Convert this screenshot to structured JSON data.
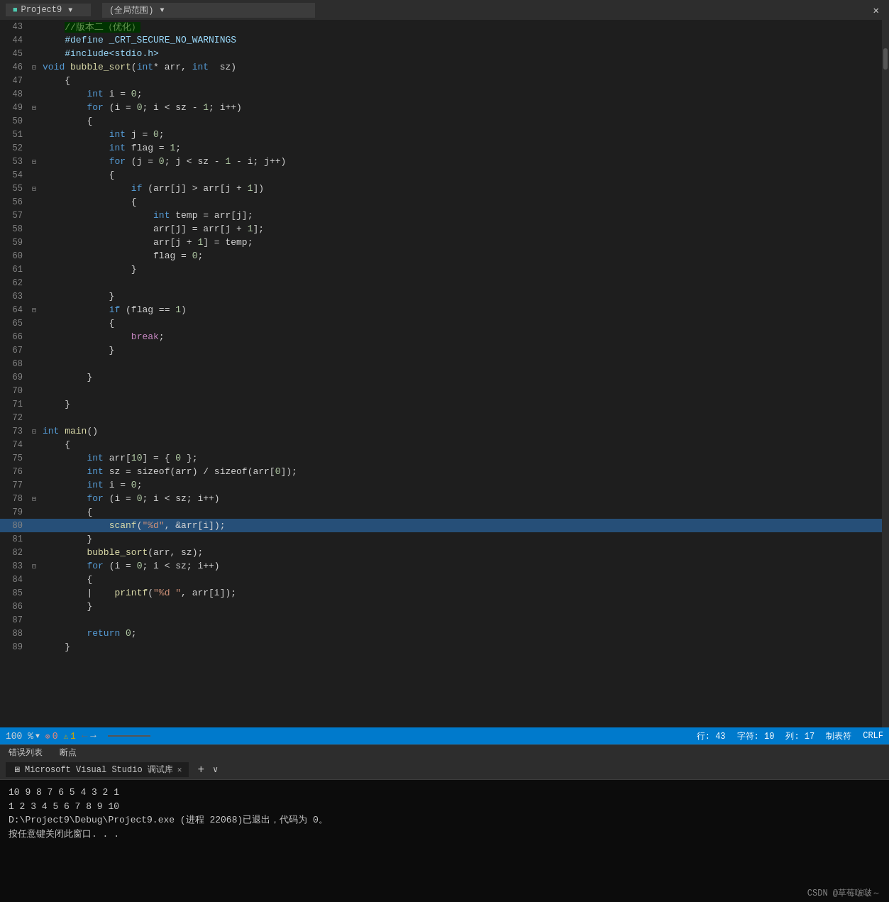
{
  "titlebar": {
    "project": "Project9",
    "scope": "(全局范围)",
    "close": "✕"
  },
  "code": {
    "lines": [
      {
        "num": "43",
        "fold": "",
        "content": [
          {
            "t": "    ",
            "c": ""
          },
          {
            "t": "//版本二（优化）",
            "c": "comment"
          }
        ]
      },
      {
        "num": "44",
        "fold": "",
        "content": [
          {
            "t": "    #define _CRT_SECURE_NO_WARNINGS",
            "c": "prep"
          }
        ]
      },
      {
        "num": "45",
        "fold": "",
        "content": [
          {
            "t": "    #include<stdio.h>",
            "c": "prep2"
          }
        ]
      },
      {
        "num": "46",
        "fold": "⊟",
        "content": [
          {
            "t": "void ",
            "c": "kw"
          },
          {
            "t": "bubble_sort",
            "c": "fn"
          },
          {
            "t": "(",
            "c": "punct"
          },
          {
            "t": "int",
            "c": "kw"
          },
          {
            "t": "* arr, ",
            "c": "op"
          },
          {
            "t": "int",
            "c": "kw"
          },
          {
            "t": "  sz)",
            "c": "op"
          }
        ]
      },
      {
        "num": "47",
        "fold": "",
        "content": [
          {
            "t": "    {",
            "c": ""
          }
        ]
      },
      {
        "num": "48",
        "fold": "",
        "content": [
          {
            "t": "        ",
            "c": ""
          },
          {
            "t": "int",
            "c": "kw"
          },
          {
            "t": " i = ",
            "c": "op"
          },
          {
            "t": "0",
            "c": "num"
          },
          {
            "t": ";",
            "c": "op"
          }
        ]
      },
      {
        "num": "49",
        "fold": "⊟",
        "content": [
          {
            "t": "        ",
            "c": ""
          },
          {
            "t": "for",
            "c": "kw"
          },
          {
            "t": " (i = ",
            "c": "op"
          },
          {
            "t": "0",
            "c": "num"
          },
          {
            "t": "; i < sz - ",
            "c": "op"
          },
          {
            "t": "1",
            "c": "num"
          },
          {
            "t": "; i++)",
            "c": "op"
          }
        ]
      },
      {
        "num": "50",
        "fold": "",
        "content": [
          {
            "t": "        {",
            "c": ""
          }
        ]
      },
      {
        "num": "51",
        "fold": "",
        "content": [
          {
            "t": "            ",
            "c": ""
          },
          {
            "t": "int",
            "c": "kw"
          },
          {
            "t": " j = ",
            "c": "op"
          },
          {
            "t": "0",
            "c": "num"
          },
          {
            "t": ";",
            "c": "op"
          }
        ]
      },
      {
        "num": "52",
        "fold": "",
        "content": [
          {
            "t": "            ",
            "c": ""
          },
          {
            "t": "int",
            "c": "kw"
          },
          {
            "t": " flag = ",
            "c": "op"
          },
          {
            "t": "1",
            "c": "num"
          },
          {
            "t": ";",
            "c": "op"
          }
        ]
      },
      {
        "num": "53",
        "fold": "⊟",
        "content": [
          {
            "t": "            ",
            "c": ""
          },
          {
            "t": "for",
            "c": "kw"
          },
          {
            "t": " (j = ",
            "c": "op"
          },
          {
            "t": "0",
            "c": "num"
          },
          {
            "t": "; j < sz - ",
            "c": "op"
          },
          {
            "t": "1",
            "c": "num"
          },
          {
            "t": " - i; j++)",
            "c": "op"
          }
        ]
      },
      {
        "num": "54",
        "fold": "",
        "content": [
          {
            "t": "            {",
            "c": ""
          }
        ]
      },
      {
        "num": "55",
        "fold": "⊟",
        "content": [
          {
            "t": "                ",
            "c": ""
          },
          {
            "t": "if",
            "c": "kw"
          },
          {
            "t": " (arr[j] > arr[j + ",
            "c": "op"
          },
          {
            "t": "1",
            "c": "num"
          },
          {
            "t": "])",
            "c": "op"
          }
        ]
      },
      {
        "num": "56",
        "fold": "",
        "content": [
          {
            "t": "                {",
            "c": ""
          }
        ]
      },
      {
        "num": "57",
        "fold": "",
        "content": [
          {
            "t": "                    ",
            "c": ""
          },
          {
            "t": "int",
            "c": "kw"
          },
          {
            "t": " temp = arr[j];",
            "c": "op"
          }
        ]
      },
      {
        "num": "58",
        "fold": "",
        "content": [
          {
            "t": "                    arr[j] = arr[j + ",
            "c": "op"
          },
          {
            "t": "1",
            "c": "num"
          },
          {
            "t": "];",
            "c": "op"
          }
        ]
      },
      {
        "num": "59",
        "fold": "",
        "content": [
          {
            "t": "                    arr[j + ",
            "c": "op"
          },
          {
            "t": "1",
            "c": "num"
          },
          {
            "t": "] = temp;",
            "c": "op"
          }
        ]
      },
      {
        "num": "60",
        "fold": "",
        "content": [
          {
            "t": "                    flag = ",
            "c": "op"
          },
          {
            "t": "0",
            "c": "num"
          },
          {
            "t": ";",
            "c": "op"
          }
        ]
      },
      {
        "num": "61",
        "fold": "",
        "content": [
          {
            "t": "                }",
            "c": ""
          }
        ]
      },
      {
        "num": "62",
        "fold": "",
        "content": [
          {
            "t": "",
            "c": ""
          }
        ]
      },
      {
        "num": "63",
        "fold": "",
        "content": [
          {
            "t": "            }",
            "c": ""
          }
        ]
      },
      {
        "num": "64",
        "fold": "⊟",
        "content": [
          {
            "t": "            ",
            "c": ""
          },
          {
            "t": "if",
            "c": "kw"
          },
          {
            "t": " (flag == ",
            "c": "op"
          },
          {
            "t": "1",
            "c": "num"
          },
          {
            "t": ")",
            "c": "op"
          }
        ]
      },
      {
        "num": "65",
        "fold": "",
        "content": [
          {
            "t": "            {",
            "c": ""
          }
        ]
      },
      {
        "num": "66",
        "fold": "",
        "content": [
          {
            "t": "                ",
            "c": ""
          },
          {
            "t": "break",
            "c": "kw2"
          },
          {
            "t": ";",
            "c": "op"
          }
        ]
      },
      {
        "num": "67",
        "fold": "",
        "content": [
          {
            "t": "            }",
            "c": ""
          }
        ]
      },
      {
        "num": "68",
        "fold": "",
        "content": [
          {
            "t": "",
            "c": ""
          }
        ]
      },
      {
        "num": "69",
        "fold": "",
        "content": [
          {
            "t": "        }",
            "c": ""
          }
        ]
      },
      {
        "num": "70",
        "fold": "",
        "content": [
          {
            "t": "",
            "c": ""
          }
        ]
      },
      {
        "num": "71",
        "fold": "",
        "content": [
          {
            "t": "    }",
            "c": ""
          }
        ]
      },
      {
        "num": "72",
        "fold": "",
        "content": [
          {
            "t": "",
            "c": ""
          }
        ]
      },
      {
        "num": "73",
        "fold": "⊟",
        "content": [
          {
            "t": "int",
            "c": "kw"
          },
          {
            "t": " ",
            "c": ""
          },
          {
            "t": "main",
            "c": "fn"
          },
          {
            "t": "()",
            "c": "op"
          }
        ]
      },
      {
        "num": "74",
        "fold": "",
        "content": [
          {
            "t": "    {",
            "c": ""
          }
        ]
      },
      {
        "num": "75",
        "fold": "",
        "content": [
          {
            "t": "        ",
            "c": ""
          },
          {
            "t": "int",
            "c": "kw"
          },
          {
            "t": " arr[",
            "c": "op"
          },
          {
            "t": "10",
            "c": "num"
          },
          {
            "t": "] = { ",
            "c": "op"
          },
          {
            "t": "0",
            "c": "num"
          },
          {
            "t": " };",
            "c": "op"
          }
        ]
      },
      {
        "num": "76",
        "fold": "",
        "content": [
          {
            "t": "        ",
            "c": ""
          },
          {
            "t": "int",
            "c": "kw"
          },
          {
            "t": " sz = sizeof(arr) / sizeof(arr[",
            "c": "op"
          },
          {
            "t": "0",
            "c": "num"
          },
          {
            "t": "]);",
            "c": "op"
          }
        ]
      },
      {
        "num": "77",
        "fold": "",
        "content": [
          {
            "t": "        ",
            "c": ""
          },
          {
            "t": "int",
            "c": "kw"
          },
          {
            "t": " i = ",
            "c": "op"
          },
          {
            "t": "0",
            "c": "num"
          },
          {
            "t": ";",
            "c": "op"
          }
        ]
      },
      {
        "num": "78",
        "fold": "⊟",
        "content": [
          {
            "t": "        ",
            "c": ""
          },
          {
            "t": "for",
            "c": "kw"
          },
          {
            "t": " (i = ",
            "c": "op"
          },
          {
            "t": "0",
            "c": "num"
          },
          {
            "t": "; i < sz; i++)",
            "c": "op"
          }
        ]
      },
      {
        "num": "79",
        "fold": "",
        "content": [
          {
            "t": "        {",
            "c": ""
          }
        ]
      },
      {
        "num": "80",
        "fold": "",
        "content": [
          {
            "t": "            ",
            "c": ""
          },
          {
            "t": "scanf",
            "c": "fn"
          },
          {
            "t": "(",
            "c": "op"
          },
          {
            "t": "\"%d\"",
            "c": "str"
          },
          {
            "t": ", &arr[i]);",
            "c": "op"
          }
        ],
        "highlight": true
      },
      {
        "num": "81",
        "fold": "",
        "content": [
          {
            "t": "        }",
            "c": ""
          }
        ]
      },
      {
        "num": "82",
        "fold": "",
        "content": [
          {
            "t": "        ",
            "c": ""
          },
          {
            "t": "bubble_sort",
            "c": "fn"
          },
          {
            "t": "(arr, sz);",
            "c": "op"
          }
        ]
      },
      {
        "num": "83",
        "fold": "⊟",
        "content": [
          {
            "t": "        ",
            "c": ""
          },
          {
            "t": "for",
            "c": "kw"
          },
          {
            "t": " (i = ",
            "c": "op"
          },
          {
            "t": "0",
            "c": "num"
          },
          {
            "t": "; i < sz; i++)",
            "c": "op"
          }
        ]
      },
      {
        "num": "84",
        "fold": "",
        "content": [
          {
            "t": "        {",
            "c": ""
          }
        ]
      },
      {
        "num": "85",
        "fold": "",
        "content": [
          {
            "t": "        |    ",
            "c": ""
          },
          {
            "t": "printf",
            "c": "fn"
          },
          {
            "t": "(",
            "c": "op"
          },
          {
            "t": "\"%d \"",
            "c": "str"
          },
          {
            "t": ", arr[i]);",
            "c": "op"
          }
        ]
      },
      {
        "num": "86",
        "fold": "",
        "content": [
          {
            "t": "        }",
            "c": ""
          }
        ]
      },
      {
        "num": "87",
        "fold": "",
        "content": [
          {
            "t": "",
            "c": ""
          }
        ]
      },
      {
        "num": "88",
        "fold": "",
        "content": [
          {
            "t": "        ",
            "c": ""
          },
          {
            "t": "return",
            "c": "kw"
          },
          {
            "t": " ",
            "c": ""
          },
          {
            "t": "0",
            "c": "num"
          },
          {
            "t": ";",
            "c": "op"
          }
        ]
      },
      {
        "num": "89",
        "fold": "",
        "content": [
          {
            "t": "    }",
            "c": ""
          }
        ]
      }
    ]
  },
  "statusbar": {
    "zoom": "100 %",
    "errors": "0",
    "warnings": "1",
    "row": "行: 43",
    "col": "字符: 10",
    "colnum": "列: 17",
    "encoding": "制表符",
    "eol": "CRLF"
  },
  "bottomtabs": {
    "items": [
      "错误列表",
      "断点"
    ]
  },
  "console": {
    "tab_label": "Microsoft Visual Studio 调试库",
    "close": "✕",
    "add": "+",
    "arrow": "∨",
    "lines": [
      "10 9 8 7 6 5 4 3 2 1",
      "1 2 3 4 5 6 7 8 9 10",
      "D:\\Project9\\Debug\\Project9.exe (进程 22068)已退出，代码为 0。",
      "按任意键关闭此窗口. . ."
    ],
    "brand": "CSDN @草莓啵啵～"
  }
}
